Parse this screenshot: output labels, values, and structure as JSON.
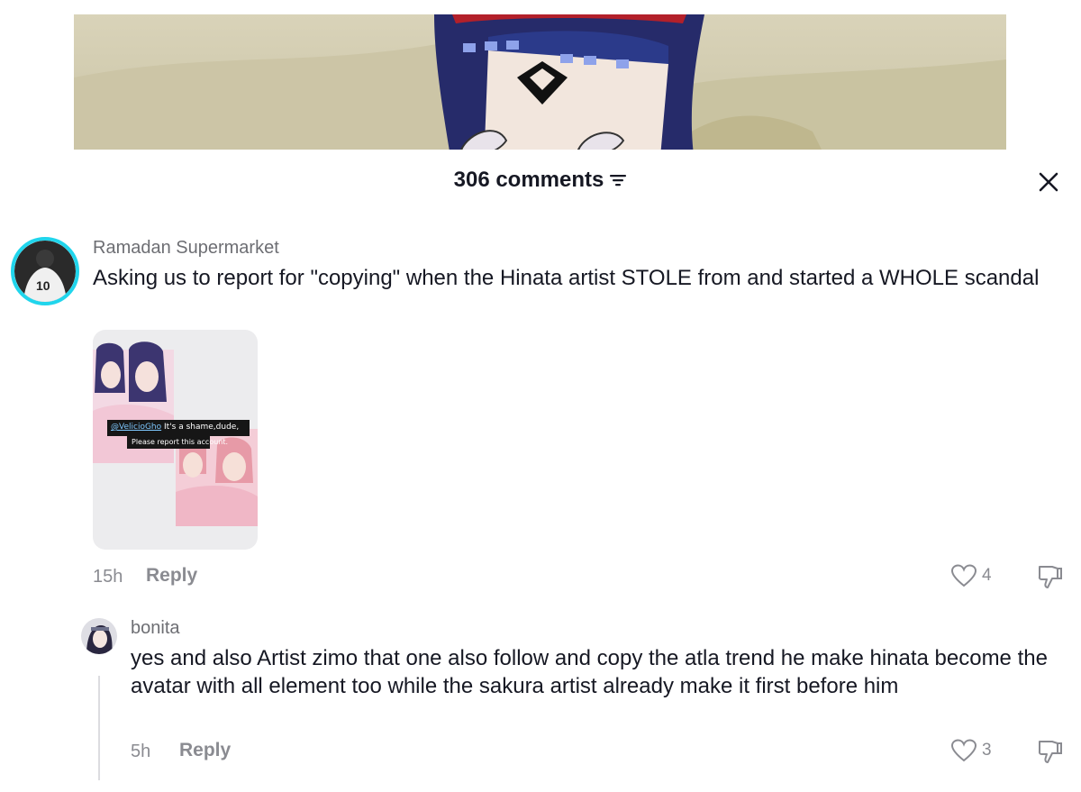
{
  "header": {
    "comments_label": "306 comments"
  },
  "comments": [
    {
      "username": "Ramadan Supermarket",
      "text": "Asking us to report for \"copying\" when the Hinata artist STOLE from and started a WHOLE scandal",
      "attachment": {
        "caption_handle": "@VelicioGho",
        "caption_text": " It's a shame,dude,",
        "caption_line2": "Please report this account."
      },
      "time": "15h",
      "reply_label": "Reply",
      "likes": "4"
    },
    {
      "username": "bonita",
      "text": "yes and also Artist zimo that one also follow and copy the atla trend he make hinata become the avatar with all element too while the sakura artist already make it first before him",
      "time": "5h",
      "reply_label": "Reply",
      "likes": "3"
    }
  ],
  "icons": {
    "sort": "sort-icon",
    "close": "close-icon",
    "like": "heart-icon",
    "dislike": "thumbs-down-icon"
  },
  "colors": {
    "text_primary": "#161823",
    "text_secondary": "#8a8b91",
    "avatar_ring": "#20d5ec"
  }
}
